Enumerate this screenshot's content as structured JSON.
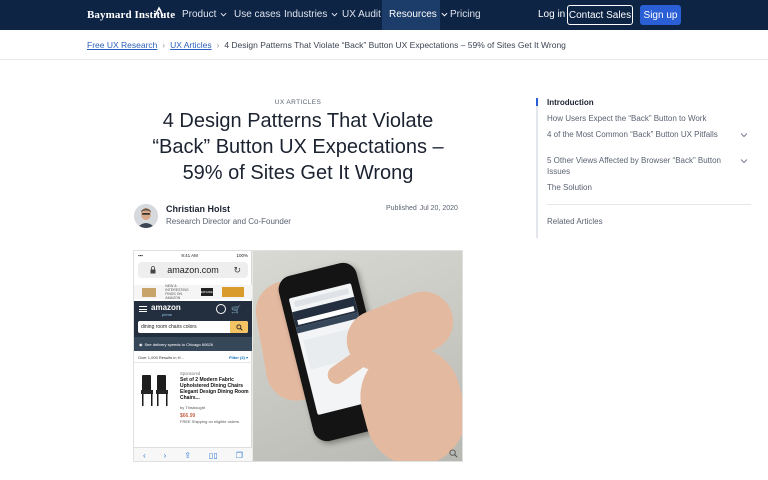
{
  "colors": {
    "nav_background": "#0e2444",
    "nav_active": "#1c3c69",
    "primary_button": "#2a5fd6",
    "link": "#2c5fb8"
  },
  "nav": {
    "logo_text": "Baymard Institute",
    "items": [
      {
        "label": "Product",
        "has_dropdown": true
      },
      {
        "label": "Use cases",
        "has_dropdown": false
      },
      {
        "label": "Industries",
        "has_dropdown": true
      },
      {
        "label": "UX Audit",
        "has_dropdown": false
      },
      {
        "label": "Resources",
        "has_dropdown": true,
        "active": true
      },
      {
        "label": "Pricing",
        "has_dropdown": false
      }
    ],
    "login": "Log in",
    "contact_sales": "Contact Sales",
    "sign_up": "Sign up"
  },
  "breadcrumb": {
    "items": [
      "Free UX Research",
      "UX Articles"
    ],
    "current": "4 Design Patterns That Violate “Back” Button UX Expectations – 59% of Sites Get It Wrong"
  },
  "article": {
    "kicker": "UX ARTICLES",
    "title": "4 Design Patterns That Violate “Back” Button UX Expectations – 59% of Sites Get It Wrong",
    "author_name": "Christian Holst",
    "author_role": "Research Director and Co-Founder",
    "published_label": "Published",
    "published_date": "Jul 20, 2020"
  },
  "hero": {
    "status_time": "9:41 AM",
    "status_battery": "100%",
    "url": "amazon.com",
    "ad_text": "NEW & INTERESTING FINDS ON AMAZON",
    "ad_badge": "EXPLORE",
    "amazon_logo": "amazon",
    "amazon_sub": "prime",
    "search_query": "dining room chairs colors",
    "delivery_text": "See delivery speeds to Chicago 60626",
    "results_text": "Over 1,000 Results in H...",
    "filter_text": "Filter (2) ▾",
    "sponsored": "Sponsored",
    "product_title": "Set of 2 Modern Fabric Upholstered Dining Chairs Elegant Design Dining Room Chairs...",
    "product_by": "by Thisbought",
    "product_price": "$66.99",
    "product_shipping": "FREE Shipping on eligible orders"
  },
  "toc": {
    "items": [
      {
        "label": "Introduction",
        "active": true,
        "expandable": false
      },
      {
        "label": "How Users Expect the “Back” Button to Work",
        "active": false,
        "expandable": false
      },
      {
        "label": "4 of the Most Common “Back” Button UX Pitfalls",
        "active": false,
        "expandable": true
      },
      {
        "label": "5 Other Views Affected by Browser “Back” Button Issues",
        "active": false,
        "expandable": true
      },
      {
        "label": "The Solution",
        "active": false,
        "expandable": false
      }
    ],
    "related": "Related Articles"
  }
}
